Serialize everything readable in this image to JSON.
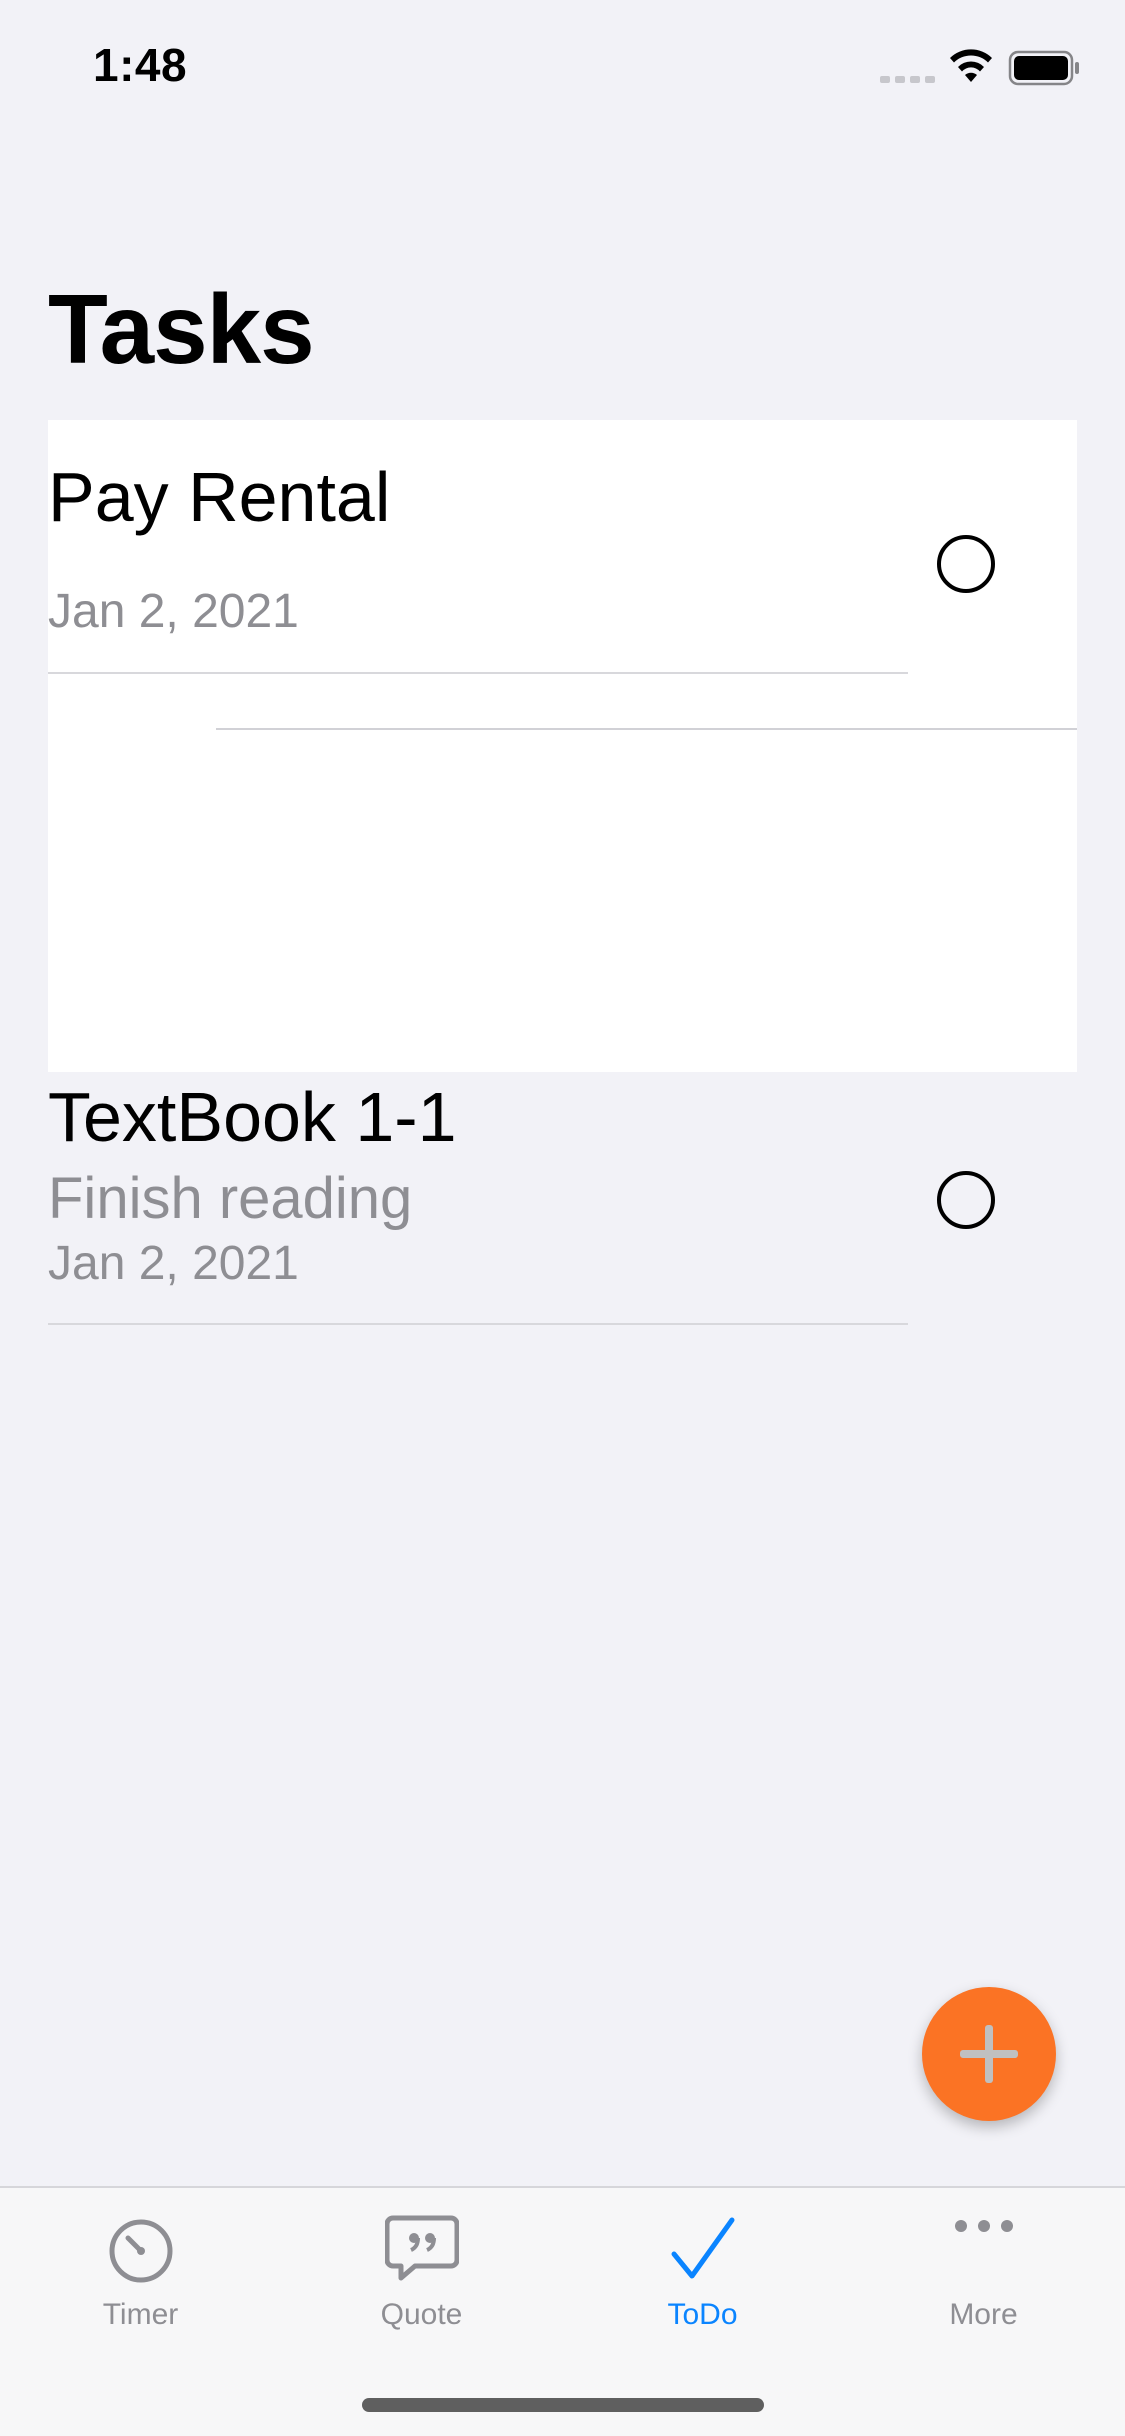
{
  "status_bar": {
    "time": "1:48"
  },
  "page": {
    "title": "Tasks"
  },
  "tasks": [
    {
      "title": "Pay Rental",
      "note": "",
      "date": "Jan 2, 2021",
      "completed": false
    },
    {
      "title": "TextBook 1-1",
      "note": "Finish reading",
      "date": "Jan 2, 2021",
      "completed": false
    }
  ],
  "fab": {
    "icon": "plus-icon"
  },
  "tab_bar": {
    "items": [
      {
        "label": "Timer",
        "icon": "timer-icon",
        "active": false
      },
      {
        "label": "Quote",
        "icon": "quote-bubble-icon",
        "active": false
      },
      {
        "label": "ToDo",
        "icon": "checkmark-icon",
        "active": true
      },
      {
        "label": "More",
        "icon": "ellipsis-icon",
        "active": false
      }
    ]
  },
  "colors": {
    "background": "#f2f2f7",
    "accent": "#0a84ff",
    "fab": "#fb7324",
    "secondary_text": "#8e8e93"
  }
}
